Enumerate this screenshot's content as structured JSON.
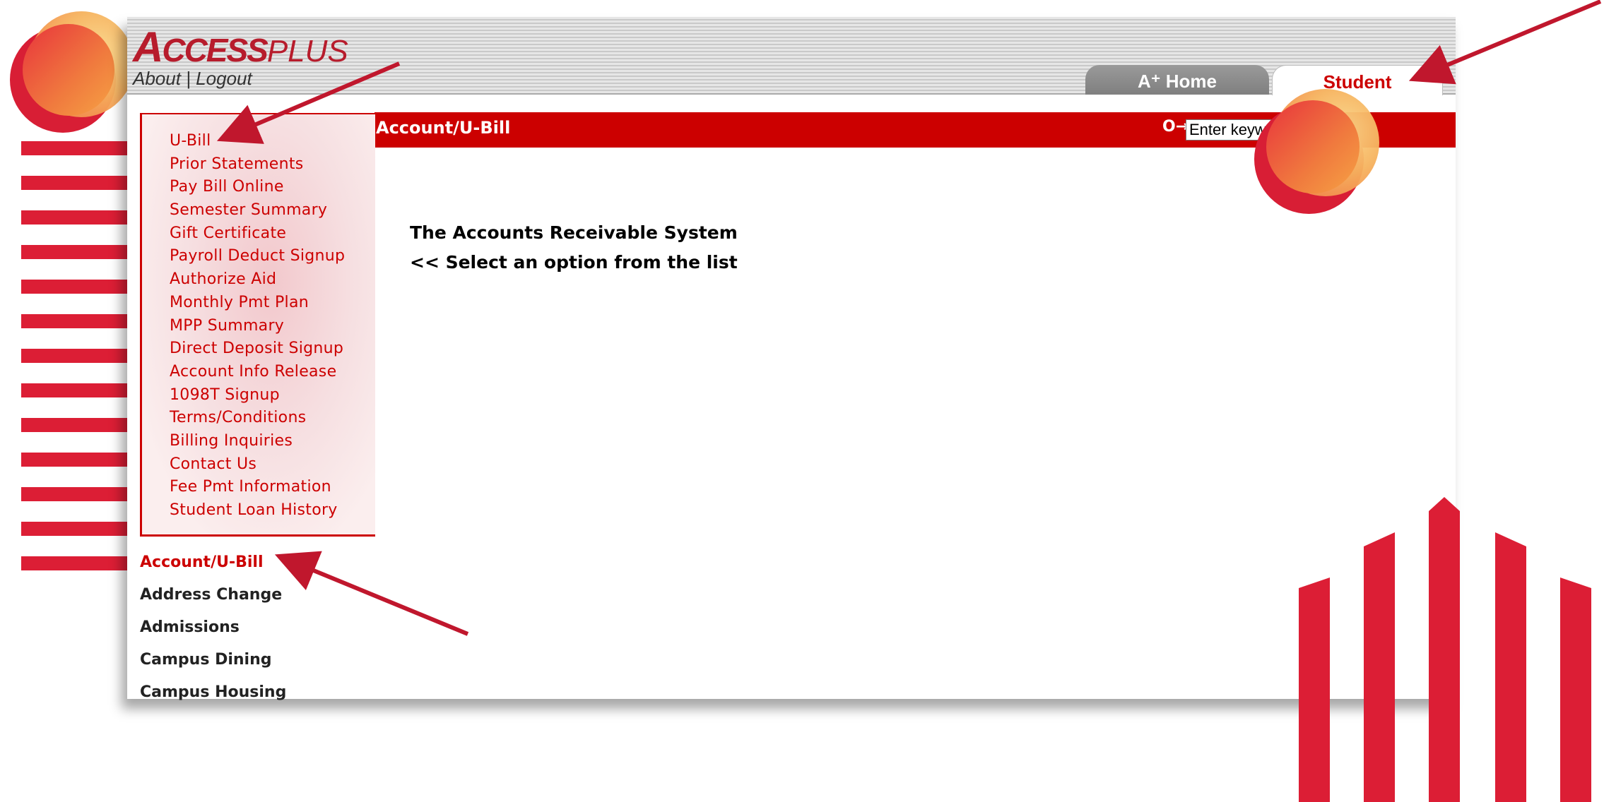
{
  "app": {
    "logo_text": "ACCESSPLUS",
    "logo_a": "A",
    "logo_plus": "+",
    "logo_ccess": "CCESS",
    "logo_plus_word": "PLUS",
    "header_links": "About | Logout",
    "tabs": [
      {
        "label": "A⁺ Home"
      },
      {
        "label": "Student"
      }
    ]
  },
  "title_bar": {
    "title": "Account/U-Bill",
    "key_icon": "key-icon",
    "search_value": "Enter keyw"
  },
  "submenu": [
    "U-Bill",
    "Prior Statements",
    "Pay Bill Online",
    "Semester Summary",
    "Gift Certificate",
    "Payroll Deduct Signup",
    "Authorize Aid",
    "Monthly Pmt Plan",
    "MPP Summary",
    "Direct Deposit Signup",
    "Account Info Release",
    "1098T Signup",
    "Terms/Conditions",
    "Billing Inquiries",
    "Contact Us",
    "Fee Pmt Information",
    "Student Loan History"
  ],
  "mainmenu": [
    "Account/U-Bill",
    "Address Change",
    "Admissions",
    "Campus Dining",
    "Campus Housing"
  ],
  "content": {
    "line1": "The Accounts Receivable System",
    "line2": "<< Select an option from the list"
  },
  "colors": {
    "accent": "#cc0000",
    "decor_red": "#dc1e35",
    "arrow": "#c0172d"
  }
}
